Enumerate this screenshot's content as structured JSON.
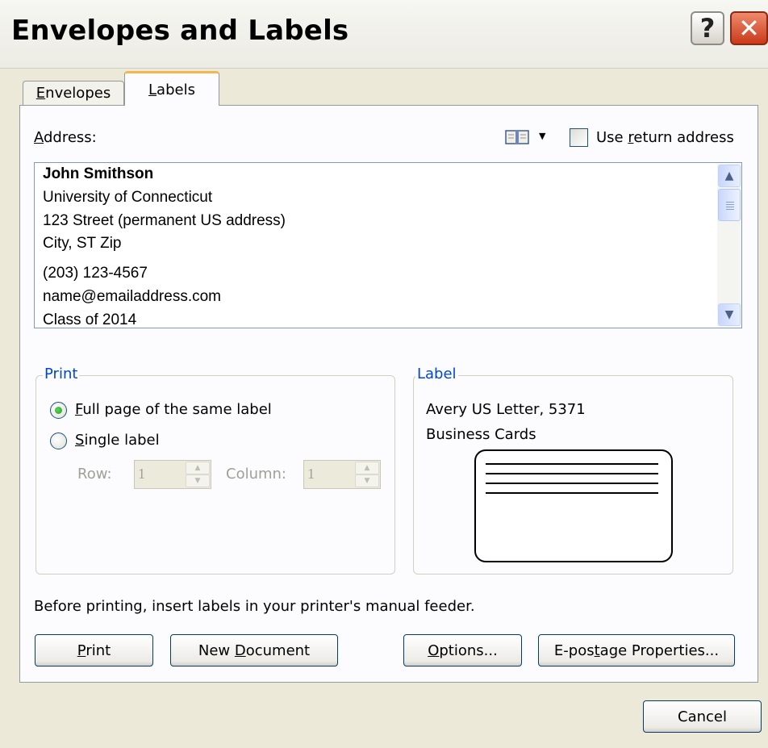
{
  "window": {
    "title": "Envelopes and Labels",
    "help_glyph": "?",
    "close_glyph": "✕"
  },
  "tabs": [
    {
      "label_u": "E",
      "label_rest": "nvelopes",
      "selected": false
    },
    {
      "label_u": "L",
      "label_rest": "abels",
      "selected": true
    }
  ],
  "address": {
    "label_u": "A",
    "label_rest": "ddress:",
    "use_return_pre": "Use ",
    "use_return_u": "r",
    "use_return_post": "eturn address",
    "use_return_checked": false,
    "lines": [
      "John Smithson",
      "University of Connecticut",
      "123 Street (permanent US address)",
      "City, ST Zip",
      "(203) 123-4567",
      "name@emailaddress.com",
      "Class of 2014"
    ]
  },
  "print_group": {
    "legend": "Print",
    "full_page_u": "F",
    "full_page_rest": "ull page of the same label",
    "single_u": "S",
    "single_rest": "ingle label",
    "selected": "full_page",
    "row_label": "Row:",
    "row_value": "1",
    "column_label": "Column:",
    "column_value": "1"
  },
  "label_group": {
    "legend": "Label",
    "vendor": "Avery US Letter, 5371",
    "product": "Business Cards"
  },
  "hint": "Before printing, insert labels in your printer's manual feeder.",
  "buttons": {
    "print_u": "P",
    "print_rest": "rint",
    "newdoc_pre": "New ",
    "newdoc_u": "D",
    "newdoc_rest": "ocument",
    "options_u": "O",
    "options_rest": "ptions...",
    "epostage_pre": "E-pos",
    "epostage_u": "t",
    "epostage_rest": "age Properties...",
    "cancel": "Cancel"
  },
  "colors": {
    "dialog_bg": "#ece9d8",
    "group_legend": "#0046d5",
    "tab_highlight": "#f7b64c",
    "close_button": "#c9391b"
  }
}
